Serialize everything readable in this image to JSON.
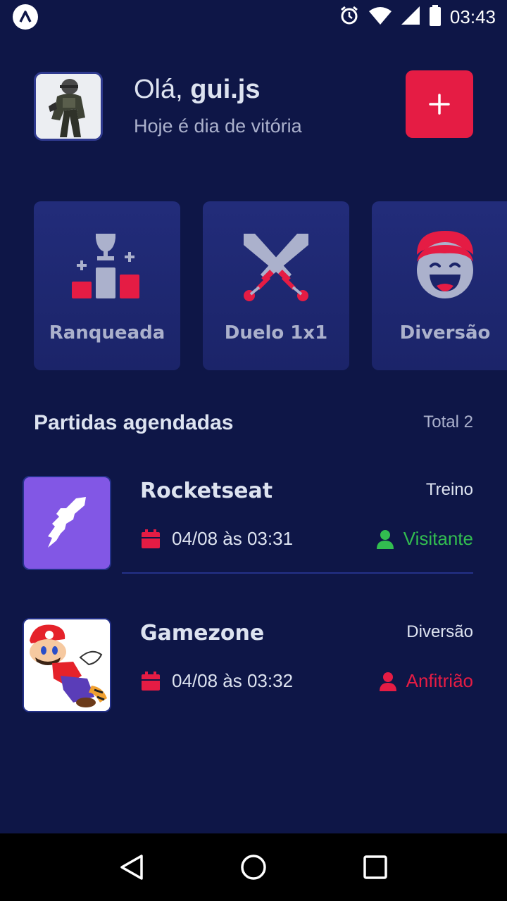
{
  "status_bar": {
    "time": "03:43",
    "icons": [
      "app-logo-icon",
      "alarm-icon",
      "wifi-icon",
      "signal-icon",
      "battery-icon"
    ]
  },
  "header": {
    "greeting_prefix": "Olá,",
    "username": "gui.js",
    "subtitle": "Hoje é dia de vitória",
    "add_icon": "plus-icon"
  },
  "categories": [
    {
      "label": "Ranqueada",
      "icon": "ranking-podium-icon"
    },
    {
      "label": "Duelo 1x1",
      "icon": "crossed-swords-icon"
    },
    {
      "label": "Diversão",
      "icon": "laughing-face-icon"
    }
  ],
  "section": {
    "title": "Partidas agendadas",
    "total": "Total 2"
  },
  "appointments": [
    {
      "guild": "Rocketseat",
      "category": "Treino",
      "date": "04/08 às 03:31",
      "role": "Visitante",
      "role_color": "#32BD50",
      "image_bg": "#8257E5"
    },
    {
      "guild": "Gamezone",
      "category": "Diversão",
      "date": "04/08 às 03:32",
      "role": "Anfitrião",
      "role_color": "#E51C44",
      "image_bg": "#FFFFFF"
    }
  ],
  "colors": {
    "background": "#0E1647",
    "primary": "#E51C44",
    "card": "#222C7A",
    "text": "#DDE3F0",
    "muted": "#ABB1CC",
    "success": "#32BD50"
  },
  "nav": {
    "icons": [
      "back-icon",
      "home-icon",
      "recents-icon"
    ]
  }
}
